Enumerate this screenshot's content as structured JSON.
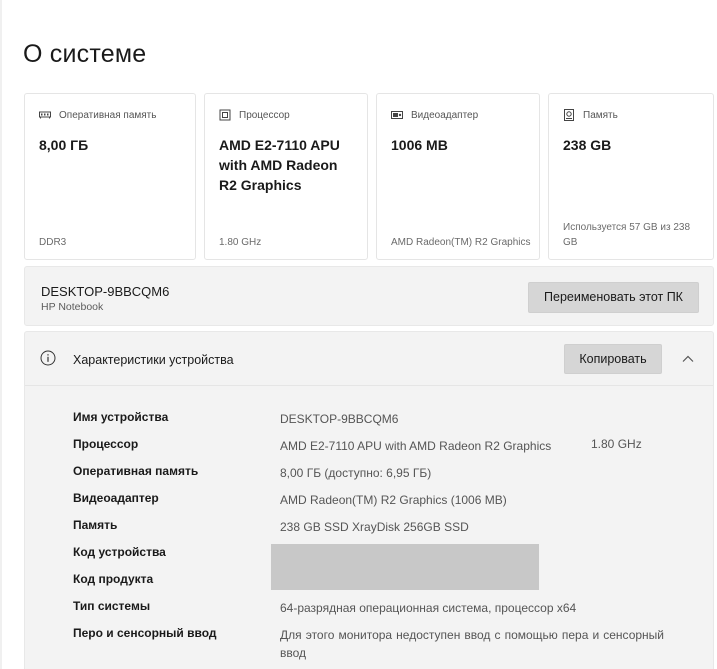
{
  "page": {
    "title": "О системе"
  },
  "cards": [
    {
      "icon": "ram-icon",
      "label": "Оперативная память",
      "value": "8,00 ГБ",
      "sub": "DDR3"
    },
    {
      "icon": "cpu-icon",
      "label": "Процессор",
      "value": "AMD E2-7110 APU with AMD Radeon R2 Graphics",
      "sub": "1.80 GHz"
    },
    {
      "icon": "gpu-icon",
      "label": "Видеоадаптер",
      "value": "1006 MB",
      "sub": "AMD Radeon(TM) R2 Graphics"
    },
    {
      "icon": "storage-icon",
      "label": "Память",
      "value": "238 GB",
      "sub": "Используется 57 GB из 238 GB"
    }
  ],
  "device": {
    "name": "DESKTOP-9BBCQM6",
    "model": "HP Notebook",
    "rename_label": "Переименовать этот ПК"
  },
  "specs": {
    "title": "Характеристики устройства",
    "copy_label": "Копировать",
    "rows": [
      {
        "key": "Имя устройства",
        "value": "DESKTOP-9BBCQM6"
      },
      {
        "key": "Процессор",
        "value": "AMD E2-7110 APU with AMD Radeon R2 Graphics",
        "extra": "1.80 GHz"
      },
      {
        "key": "Оперативная память",
        "value": "8,00 ГБ (доступно: 6,95 ГБ)"
      },
      {
        "key": "Видеоадаптер",
        "value": "AMD Radeon(TM) R2 Graphics (1006 MB)"
      },
      {
        "key": "Память",
        "value": "238 GB SSD XrayDisk 256GB SSD"
      },
      {
        "key": "Код устройства",
        "value": ""
      },
      {
        "key": "Код продукта",
        "value": ""
      },
      {
        "key": "Тип системы",
        "value": "64-разрядная операционная система, процессор x64"
      },
      {
        "key": "Перо и сенсорный ввод",
        "value": "Для этого монитора недоступен ввод с помощью пера и сенсорный ввод"
      }
    ]
  }
}
